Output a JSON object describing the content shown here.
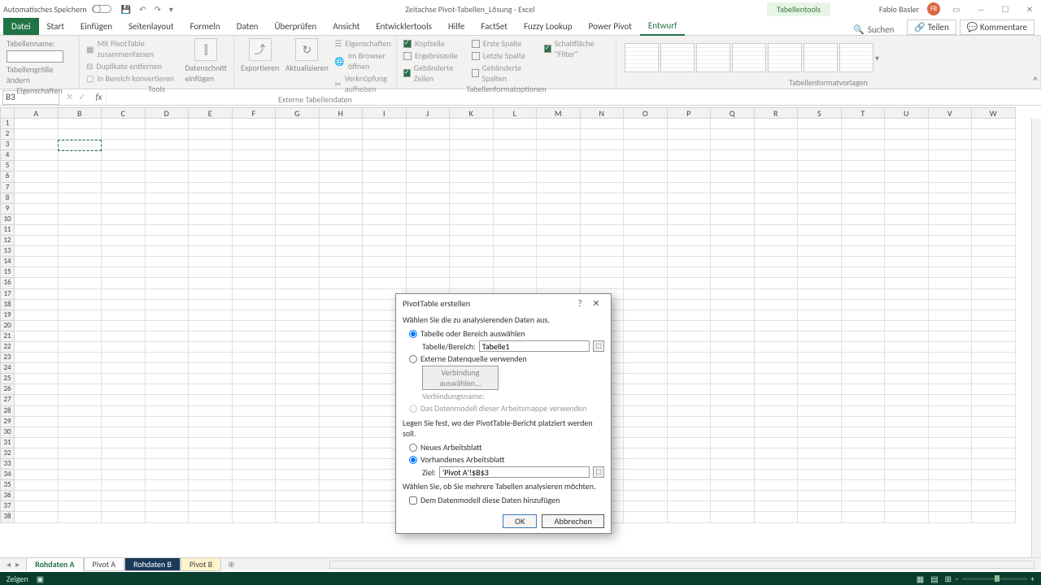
{
  "titlebar": {
    "autosave": "Automatisches Speichern",
    "docname": "Zeitachse Pivot-Tabellen_Lösung - Excel",
    "context": "Tabellentools",
    "user": "Fabio Basler",
    "avatar": "FB"
  },
  "tabs": {
    "file": "Datei",
    "items": [
      "Start",
      "Einfügen",
      "Seitenlayout",
      "Formeln",
      "Daten",
      "Überprüfen",
      "Ansicht",
      "Entwicklertools",
      "Hilfe",
      "FactSet",
      "Fuzzy Lookup",
      "Power Pivot",
      "Entwurf"
    ],
    "active": "Entwurf",
    "search": "Suchen",
    "share": "Teilen",
    "comments": "Kommentare"
  },
  "ribbon": {
    "props_label": "Tabellenname:",
    "props_resize": "Tabellengröße ändern",
    "group_props": "Eigenschaften",
    "tools": [
      "Mit PivotTable zusammenfassen",
      "Duplikate entfernen",
      "In Bereich konvertieren"
    ],
    "slicer": "Datenschnitt einfügen",
    "export": "Exportieren",
    "refresh": "Aktualisieren",
    "ext_items": [
      "Eigenschaften",
      "Im Browser öffnen",
      "Verknüpfung aufheben"
    ],
    "group_tools": "Tools",
    "group_ext": "Externe Tabellendaten",
    "opts_l": [
      "Kopfzeile",
      "Ergebniszeile",
      "Gebänderte Zeilen"
    ],
    "opts_m": [
      "Erste Spalte",
      "Letzte Spalte",
      "Gebänderte Spalten"
    ],
    "opts_r": "Schaltfläche \"Filter\"",
    "group_opts": "Tabellenformatoptionen",
    "group_styles": "Tabellenformatvorlagen"
  },
  "namebox": "B3",
  "cols": [
    "A",
    "B",
    "C",
    "D",
    "E",
    "F",
    "G",
    "H",
    "I",
    "J",
    "K",
    "L",
    "M",
    "N",
    "O",
    "P",
    "Q",
    "R",
    "S",
    "T",
    "U",
    "V",
    "W"
  ],
  "sheets": {
    "nav": [
      "◂",
      "▸"
    ],
    "items": [
      {
        "label": "Rohdaten A",
        "cls": "active"
      },
      {
        "label": "Pivot A",
        "cls": ""
      },
      {
        "label": "Rohdaten B",
        "cls": "dark"
      },
      {
        "label": "Pivot B",
        "cls": "yellow"
      }
    ],
    "add": "⊕"
  },
  "status": {
    "mode": "Zeigen",
    "zoom": "+"
  },
  "dialog": {
    "title": "PivotTable erstellen",
    "line1": "Wählen Sie die zu analysierenden Daten aus.",
    "radio_table": "Tabelle oder Bereich auswählen",
    "lbl_range": "Tabelle/Bereich:",
    "val_range": "Tabelle1",
    "radio_ext": "Externe Datenquelle verwenden",
    "btn_conn": "Verbindung auswählen...",
    "lbl_conn": "Verbindungsname:",
    "radio_dm": "Das Datenmodell dieser Arbeitsmappe verwenden",
    "line2": "Legen Sie fest, wo der PivotTable-Bericht platziert werden soll.",
    "radio_new": "Neues Arbeitsblatt",
    "radio_exist": "Vorhandenes Arbeitsblatt",
    "lbl_loc": "Ziel:",
    "val_loc": "'Pivot A'!$B$3",
    "line3": "Wählen Sie, ob Sie mehrere Tabellen analysieren möchten.",
    "chk_dm": "Dem Datenmodell diese Daten hinzufügen",
    "ok": "OK",
    "cancel": "Abbrechen"
  }
}
